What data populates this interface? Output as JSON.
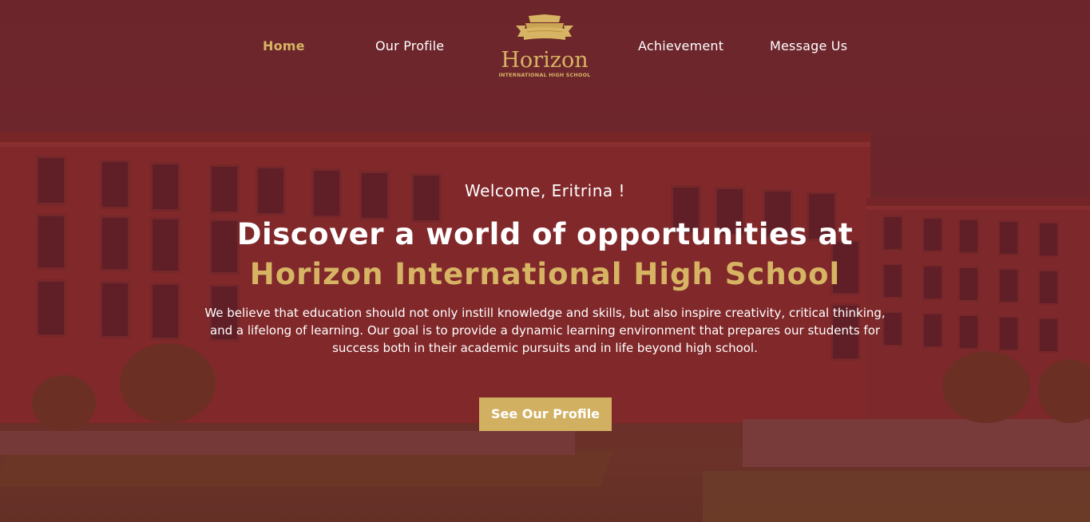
{
  "nav": {
    "items": [
      {
        "label": "Home",
        "active": true
      },
      {
        "label": "Our Profile",
        "active": false
      },
      {
        "label": "Achievement",
        "active": false
      },
      {
        "label": "Message Us",
        "active": false
      }
    ]
  },
  "logo": {
    "title": "Horizon",
    "subtitle": "INTERNATIONAL HIGH SCHOOL",
    "icon": "crest-banner-icon"
  },
  "hero": {
    "welcome": "Welcome, Eritrina !",
    "headline": "Discover a world of opportunities at",
    "school_name": "Horizon International High School",
    "description": "We believe that education should not only instill knowledge and skills, but also inspire creativity, critical thinking, and a lifelong of learning. Our goal is to provide a dynamic learning environment that prepares our students for success both in their academic pursuits and in life beyond high school.",
    "cta_label": "See Our Profile"
  },
  "colors": {
    "accent": "#d7b464",
    "overlay": "#6e1e28",
    "text": "#ffffff"
  }
}
